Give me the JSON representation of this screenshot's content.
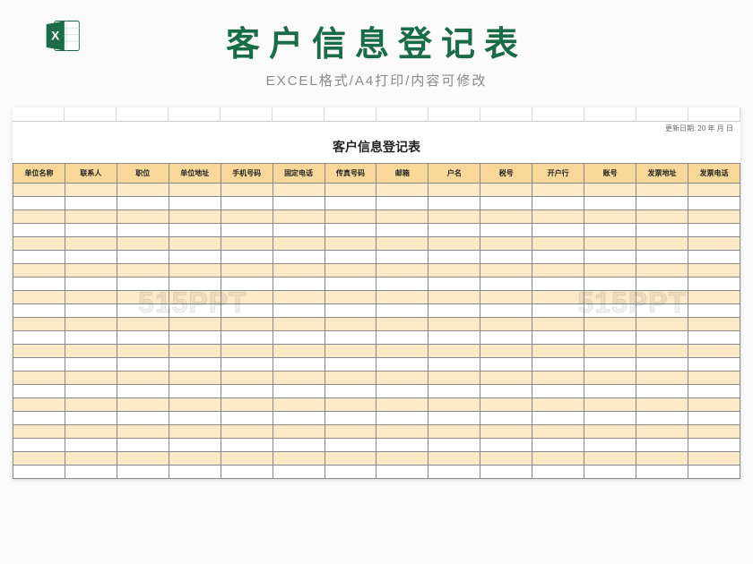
{
  "header": {
    "main_title": "客户信息登记表",
    "sub_title": "EXCEL格式/A4打印/内容可修改"
  },
  "sheet": {
    "update_label": "更新日期: 20 年 月 日",
    "title": "客户信息登记表",
    "columns": [
      "单位名称",
      "联系人",
      "职位",
      "单位地址",
      "手机号码",
      "固定电话",
      "传真号码",
      "邮箱",
      "户名",
      "税号",
      "开户行",
      "账号",
      "发票地址",
      "发票电话"
    ],
    "row_count": 22
  },
  "watermark": "515PPT",
  "colors": {
    "accent_green": "#1a6b47",
    "header_orange": "#f8d898",
    "row_alt": "#fbe9c8"
  }
}
